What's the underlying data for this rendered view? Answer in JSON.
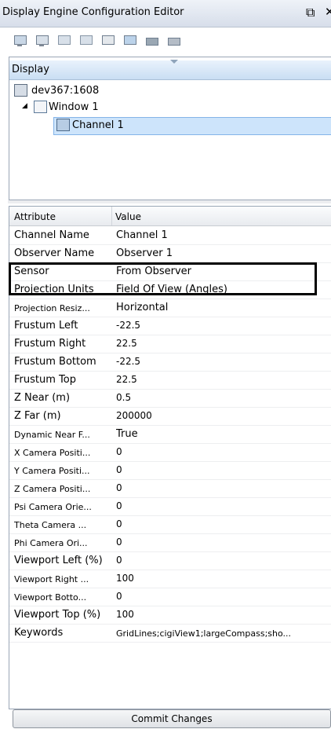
{
  "window": {
    "title": "Display Engine Configuration Editor"
  },
  "toolbar": {
    "buttons": [
      "add-display-icon",
      "add-channel-icon",
      "add-window-icon",
      "remove-window-icon",
      "copy-icon",
      "paste-icon",
      "import-icon",
      "export-icon"
    ]
  },
  "tree": {
    "header": "Display",
    "nodes": [
      {
        "label": "dev367:1608",
        "icon": "display-icon"
      },
      {
        "label": "Window 1",
        "icon": "window-icon"
      },
      {
        "label": "Channel 1",
        "icon": "channel-icon",
        "selected": true
      }
    ]
  },
  "grid": {
    "columns": {
      "attribute": "Attribute",
      "value": "Value"
    },
    "rows": [
      {
        "attribute": "Channel Name",
        "value": "Channel 1"
      },
      {
        "attribute": "Observer Name",
        "value": "Observer 1"
      },
      {
        "attribute": "Sensor",
        "value": "From Observer"
      },
      {
        "attribute": "Projection Units",
        "value": "Field Of View (Angles)"
      },
      {
        "attribute": "Projection Resiz...",
        "value": "Horizontal"
      },
      {
        "attribute": "Frustum Left",
        "value": "-22.5"
      },
      {
        "attribute": "Frustum Right",
        "value": "22.5"
      },
      {
        "attribute": "Frustum Bottom",
        "value": "-22.5"
      },
      {
        "attribute": "Frustum Top",
        "value": "22.5"
      },
      {
        "attribute": "Z Near (m)",
        "value": "0.5"
      },
      {
        "attribute": "Z Far (m)",
        "value": "200000"
      },
      {
        "attribute": "Dynamic Near F...",
        "value": "True"
      },
      {
        "attribute": "X Camera Positi...",
        "value": "0"
      },
      {
        "attribute": "Y Camera Positi...",
        "value": "0"
      },
      {
        "attribute": "Z Camera Positi...",
        "value": "0"
      },
      {
        "attribute": "Psi Camera Orie...",
        "value": "0"
      },
      {
        "attribute": "Theta Camera ...",
        "value": "0"
      },
      {
        "attribute": "Phi Camera Ori...",
        "value": "0"
      },
      {
        "attribute": "Viewport Left (%)",
        "value": "0"
      },
      {
        "attribute": "Viewport Right ...",
        "value": "100"
      },
      {
        "attribute": "Viewport Botto...",
        "value": "0"
      },
      {
        "attribute": "Viewport Top (%)",
        "value": "100"
      },
      {
        "attribute": "Keywords",
        "value": "GridLines;cigiView1;largeCompass;sho..."
      }
    ]
  },
  "actions": {
    "commit_label": "Commit Changes"
  }
}
